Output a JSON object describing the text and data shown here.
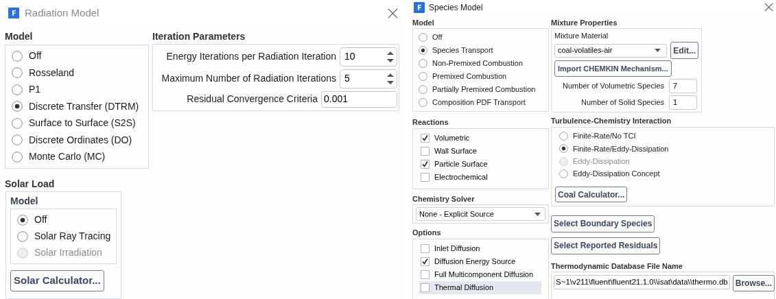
{
  "radiation_dialog": {
    "title": "Radiation Model",
    "model": {
      "heading": "Model",
      "options": [
        {
          "label": "Off",
          "selected": false,
          "disabled": false
        },
        {
          "label": "Rosseland",
          "selected": false,
          "disabled": false
        },
        {
          "label": "P1",
          "selected": false,
          "disabled": false
        },
        {
          "label": "Discrete Transfer (DTRM)",
          "selected": true,
          "disabled": false
        },
        {
          "label": "Surface to Surface (S2S)",
          "selected": false,
          "disabled": false
        },
        {
          "label": "Discrete Ordinates (DO)",
          "selected": false,
          "disabled": false
        },
        {
          "label": "Monte Carlo (MC)",
          "selected": false,
          "disabled": false
        }
      ]
    },
    "iteration_parameters": {
      "heading": "Iteration Parameters",
      "fields": [
        {
          "kind": "spinner",
          "label": "Energy Iterations per Radiation Iteration",
          "value": "10"
        },
        {
          "kind": "spinner",
          "label": "Maximum Number of Radiation Iterations",
          "value": "5"
        },
        {
          "kind": "text",
          "label": "Residual Convergence Criteria",
          "value": "0.001"
        }
      ]
    },
    "solar_load": {
      "heading": "Solar Load",
      "model_heading": "Model",
      "options": [
        {
          "label": "Off",
          "selected": true,
          "disabled": false
        },
        {
          "label": "Solar Ray Tracing",
          "selected": false,
          "disabled": false
        },
        {
          "label": "Solar Irradiation",
          "selected": false,
          "disabled": true
        }
      ],
      "button": "Solar Calculator..."
    }
  },
  "species_dialog": {
    "title": "Species Model",
    "model": {
      "heading": "Model",
      "options": [
        {
          "label": "Off",
          "selected": false,
          "disabled": false
        },
        {
          "label": "Species Transport",
          "selected": true,
          "disabled": false
        },
        {
          "label": "Non-Premixed Combustion",
          "selected": false,
          "disabled": false
        },
        {
          "label": "Premixed Combustion",
          "selected": false,
          "disabled": false
        },
        {
          "label": "Partially Premixed Combustion",
          "selected": false,
          "disabled": false
        },
        {
          "label": "Composition PDF Transport",
          "selected": false,
          "disabled": false
        }
      ]
    },
    "reactions": {
      "heading": "Reactions",
      "options": [
        {
          "label": "Volumetric",
          "checked": true,
          "highlighted": false
        },
        {
          "label": "Wall Surface",
          "checked": false,
          "highlighted": false
        },
        {
          "label": "Particle Surface",
          "checked": true,
          "highlighted": false
        },
        {
          "label": "Electrochemical",
          "checked": false,
          "highlighted": false
        }
      ]
    },
    "chemistry_solver": {
      "heading": "Chemistry Solver",
      "value": "None - Explicit Source"
    },
    "options": {
      "heading": "Options",
      "options": [
        {
          "label": "Inlet Diffusion",
          "checked": false,
          "highlighted": false
        },
        {
          "label": "Diffusion Energy Source",
          "checked": true,
          "highlighted": false
        },
        {
          "label": "Full Multicomponent Diffusion",
          "checked": false,
          "highlighted": false
        },
        {
          "label": "Thermal Diffusion",
          "checked": false,
          "highlighted": true
        }
      ]
    },
    "mixture_properties": {
      "heading": "Mixture Properties",
      "material_label": "Mixture Material",
      "material": "coal-volatiles-air",
      "edit_button": "Edit...",
      "import_button": "Import CHEMKIN Mechanism...",
      "fields": [
        {
          "label": "Number of Volumetric Species",
          "value": "7"
        },
        {
          "label": "Number of Solid Species",
          "value": "1"
        }
      ]
    },
    "turbulence_chemistry": {
      "heading": "Turbulence-Chemistry Interaction",
      "options": [
        {
          "label": "Finite-Rate/No TCI",
          "selected": false,
          "disabled": false
        },
        {
          "label": "Finite-Rate/Eddy-Dissipation",
          "selected": true,
          "disabled": false
        },
        {
          "label": "Eddy-Dissipation",
          "selected": false,
          "disabled": true
        },
        {
          "label": "Eddy-Dissipation Concept",
          "selected": false,
          "disabled": false
        }
      ],
      "button": "Coal Calculator..."
    },
    "boundary_button": "Select Boundary Species",
    "residuals_button": "Select Reported Residuals",
    "thermo_db": {
      "heading": "Thermodynamic Database File Name",
      "value": "S~1\\v211\\fluent\\fluent21.1.0\\\\isat\\data\\\\thermo.db",
      "button": "Browse..."
    }
  }
}
